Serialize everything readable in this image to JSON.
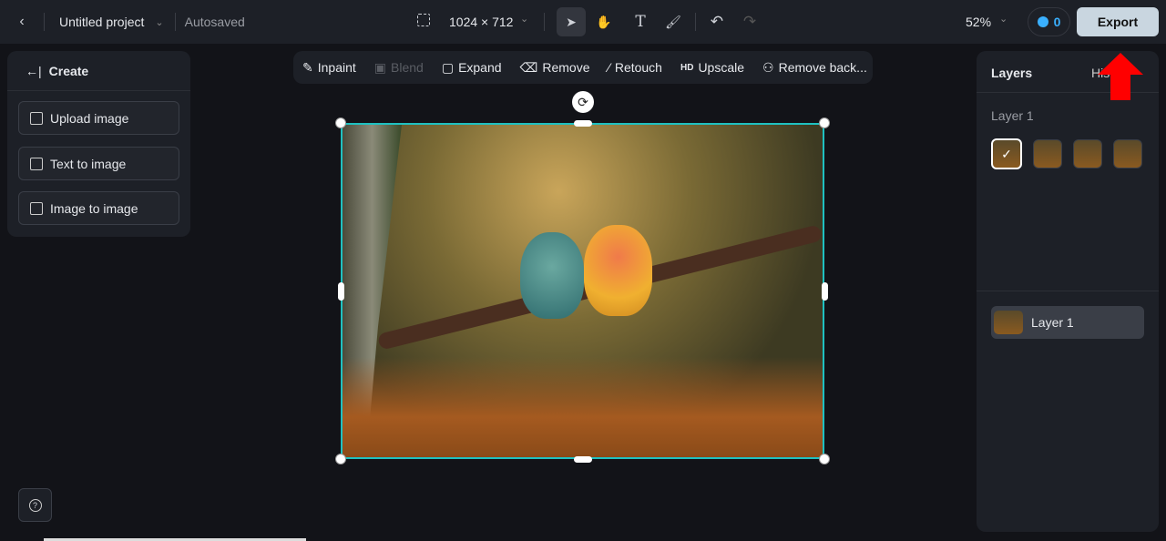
{
  "topbar": {
    "project_title": "Untitled project",
    "status": "Autosaved",
    "canvas_size": "1024 × 712",
    "zoom": "52%",
    "credits": "0",
    "export_label": "Export"
  },
  "left_panel": {
    "title": "Create",
    "buttons": [
      {
        "label": "Upload image",
        "icon": "upload-image-icon"
      },
      {
        "label": "Text to image",
        "icon": "text-to-image-icon"
      },
      {
        "label": "Image to image",
        "icon": "image-to-image-icon"
      }
    ]
  },
  "canvas_toolbar": [
    {
      "label": "Inpaint",
      "icon": "inpaint-icon",
      "enabled": true
    },
    {
      "label": "Blend",
      "icon": "blend-icon",
      "enabled": false
    },
    {
      "label": "Expand",
      "icon": "expand-icon",
      "enabled": true
    },
    {
      "label": "Remove",
      "icon": "eraser-icon",
      "enabled": true
    },
    {
      "label": "Retouch",
      "icon": "magic-wand-icon",
      "enabled": true
    },
    {
      "label": "Upscale",
      "icon": "hd-icon",
      "icon_text": "HD",
      "enabled": true
    },
    {
      "label": "Remove back...",
      "icon": "remove-background-icon",
      "enabled": true
    }
  ],
  "right_panel": {
    "tab_layers": "Layers",
    "tab_history": "History",
    "group_label": "Layer 1",
    "layer_name": "Layer 1"
  },
  "colors": {
    "selection": "#1fc1c1",
    "accent": "#3ab0ff",
    "annotation_arrow": "#ff0000"
  }
}
